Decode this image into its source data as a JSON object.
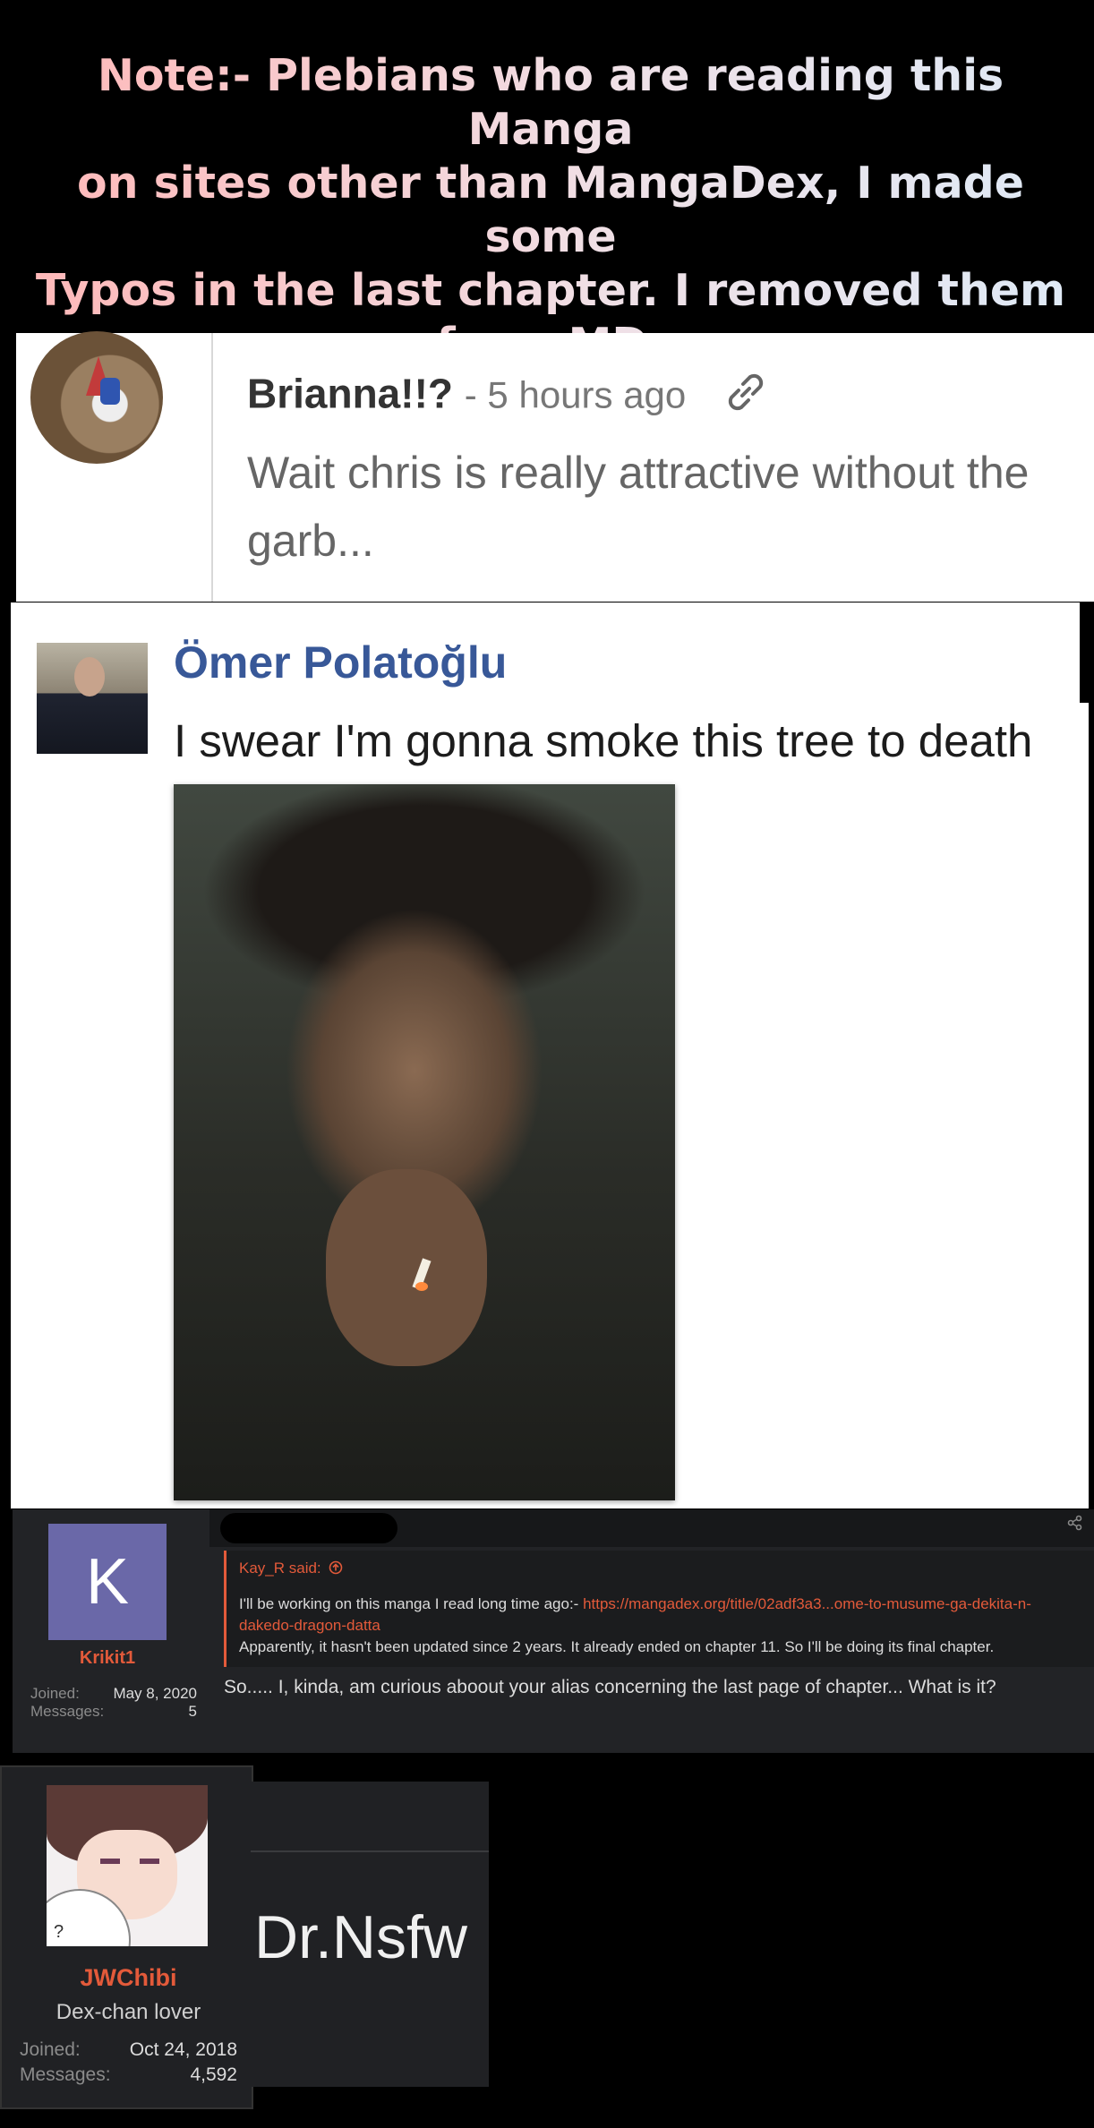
{
  "note": {
    "lines": [
      "Note:- Plebians who are reading this Manga",
      "on sites other than MangaDex, I made some",
      "Typos in the last chapter. I removed them",
      "from MD."
    ]
  },
  "comment1": {
    "author": "Brianna!!?",
    "time": "- 5 hours ago",
    "text": "Wait chris is really attractive without the garb...",
    "link_icon": "link-icon"
  },
  "fb_comment": {
    "author": "Ömer Polatoğlu",
    "text": "I swear I'm gonna smoke this tree to death",
    "image": "man-smoking-photo"
  },
  "forum_post": {
    "avatar_letter": "K",
    "username": "Krikit1",
    "joined_label": "Joined:",
    "joined_value": "May 8, 2020",
    "messages_label": "Messages:",
    "messages_value": "5",
    "quote_author": "Kay_R said:",
    "quote_text_1": "I'll be working on this manga I read long time ago:- ",
    "quote_link": "https://mangadex.org/title/02adf3a3...ome-to-musume-ga-dekita-n-dakedo-dragon-datta",
    "quote_text_2": "Apparently, it hasn't been updated since 2 years. It already ended on chapter 11. So I'll be doing its final chapter.",
    "message": "So..... I, kinda, am curious aboout your alias concerning the last page of chapter... What is it?",
    "accent": "#e35a3a"
  },
  "user_card": {
    "username": "JWChibi",
    "title": "Dex-chan lover",
    "joined_label": "Joined:",
    "joined_value": "Oct 24, 2018",
    "messages_label": "Messages:",
    "messages_value": "4,592"
  },
  "alias_card": {
    "name": "Dr.Nsfw"
  }
}
